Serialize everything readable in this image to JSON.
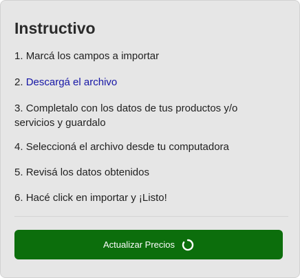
{
  "card": {
    "title": "Instructivo",
    "steps": [
      {
        "prefix": "1. ",
        "text": "Marcá los campos a importar"
      },
      {
        "prefix": "2. ",
        "link_text": "Descargá el archivo"
      },
      {
        "prefix": "3. ",
        "text": "Completalo con los datos de tus productos y/o servicios y guardalo"
      },
      {
        "prefix": "4. ",
        "text": "Seleccioná el archivo desde tu computadora"
      },
      {
        "prefix": "5. ",
        "text": "Revisá los datos obtenidos"
      },
      {
        "prefix": "6. ",
        "text": "Hacé click en importar y ¡Listo!"
      }
    ],
    "button": {
      "label": "Actualizar Precios",
      "icon": "spinner-icon"
    }
  },
  "colors": {
    "card_background": "#e6e6e6",
    "link": "#1515a6",
    "button_background": "#0c6e0c",
    "button_text": "#ffffff"
  }
}
